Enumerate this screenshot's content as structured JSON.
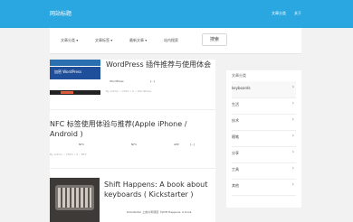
{
  "header": {
    "logo": "网站标题",
    "links": [
      "文章分类",
      "关于"
    ]
  },
  "nav": {
    "items": [
      "文章分类 ▾",
      "文章标签 ▾",
      "最新文章 ▾",
      "站内搜索"
    ],
    "search_label": "搜索"
  },
  "posts": [
    {
      "thumb_text": "加密 WordPress",
      "title": "WordPress 插件推荐与使用体会",
      "excerpt": [
        "WordPress",
        "[...]"
      ],
      "meta": "By admin • 2020 • 0 • WordPress"
    },
    {
      "title": "NFC 标签使用体验与推荐(Apple iPhone / Android )",
      "excerpt": [
        "NFC",
        "NFC",
        "APP",
        "[...]"
      ],
      "meta": "By admin • 2020 • 0 • NFC"
    },
    {
      "title": "Shift Happens: A book about keyboards ( Kickstarter )",
      "excerpt": "Kickstarter 上的众筹项目《Shift Happens: A book"
    }
  ],
  "sidebar": {
    "title": "文章分类",
    "items": [
      "keyboards",
      "生活",
      "技术",
      "随笔",
      "分享",
      "工具",
      "其他"
    ]
  },
  "colors": {
    "header": "#2aa7e0",
    "background": "#f2f2f2"
  }
}
